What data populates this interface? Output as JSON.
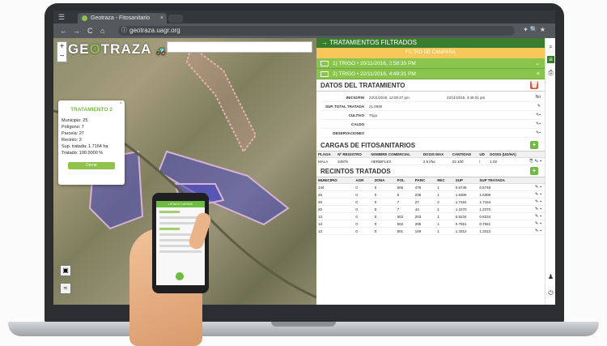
{
  "browser": {
    "tab_title": "Geotraza - Fitosanitario",
    "url": "geotraza.uagr.org",
    "nav": {
      "back": "←",
      "forward": "→",
      "reload": "C",
      "home": "⌂"
    }
  },
  "map": {
    "logo_left": "GE",
    "logo_mid": "O",
    "logo_right": "TRAZA",
    "zoom_in": "+",
    "zoom_out": "−",
    "popup": {
      "title": "TRATAMIENTO 2",
      "lines": [
        "Municipio: 25",
        "Polígono: 7",
        "Parcela: 27",
        "Recinto: 2",
        "Sup. tratada: 1.7164 ha",
        "Tratado: 100.0000 %"
      ],
      "button": "Cerrar"
    }
  },
  "panel": {
    "header": "TRATAMIENTOS FILTRADOS",
    "filter_bar": "FILTRO DE CAMPAÑA",
    "items": [
      {
        "label": "1) TRIGO • 20/11/2016, 2:58:35 PM",
        "right": "⌄"
      },
      {
        "label": "2) TRIGO • 22/11/2016, 4:49:31 PM",
        "right": "×"
      }
    ],
    "datos": {
      "title": "DATOS DEL TRATAMIENTO",
      "inicio_label": "INICIO/FIN",
      "inicio_value": "22/11/2016, 12:00:27 pm",
      "fin_value": "22/11/2016, 4:49:31 pm",
      "fin_extra": "No",
      "rows": [
        {
          "k": "SUP. TOTAL TRATADA",
          "v": "21.0090"
        },
        {
          "k": "CULTIVO",
          "v": "Trigo"
        },
        {
          "k": "CALDO",
          "v": ""
        },
        {
          "k": "OBSERVACIONES",
          "v": ""
        }
      ]
    },
    "cargas": {
      "title": "CARGAS DE FITOSANITARIOS",
      "headers": [
        "PLAGA",
        "Nº REGISTRO",
        "NOMBRE COMERCIAL",
        "DOSIS MAX",
        "CANTIDAD",
        "UD",
        "DOSIS (UD/HA)"
      ],
      "rows": [
        [
          "MALA",
          "24976",
          "HERBIFLEX",
          "2.5 l/ha",
          "22.100",
          "l",
          "1.02"
        ]
      ]
    },
    "recintos": {
      "title": "RECINTOS TRATADOS",
      "headers": [
        "MUNICIPIO",
        "AGR",
        "ZONA",
        "POL",
        "PARC",
        "REC",
        "SUP",
        "SUP TRATADA"
      ],
      "rows": [
        [
          "144",
          "0",
          "0",
          "506",
          "476",
          "1",
          "0.6748",
          "0.6748"
        ],
        [
          "25",
          "0",
          "0",
          "5",
          "236",
          "1",
          "1.6306",
          "1.6306"
        ],
        [
          "25",
          "0",
          "0",
          "7",
          "27",
          "2",
          "1.7164",
          "1.7164"
        ],
        [
          "25",
          "0",
          "0",
          "7",
          "43",
          "1",
          "1.2370",
          "1.2370"
        ],
        [
          "13",
          "0",
          "0",
          "502",
          "203",
          "1",
          "0.8234",
          "0.8234"
        ],
        [
          "13",
          "0",
          "0",
          "502",
          "205",
          "1",
          "0.7551",
          "0.7551"
        ],
        [
          "13",
          "0",
          "0",
          "501",
          "149",
          "1",
          "1.3312",
          "1.3312"
        ]
      ]
    }
  },
  "phone": {
    "bar": "LISTADO CARGAS"
  },
  "colors": {
    "brand_green": "#6dbb3f",
    "dark_green": "#3a7c2e",
    "yellow": "#f6c859",
    "red": "#e0533a"
  }
}
